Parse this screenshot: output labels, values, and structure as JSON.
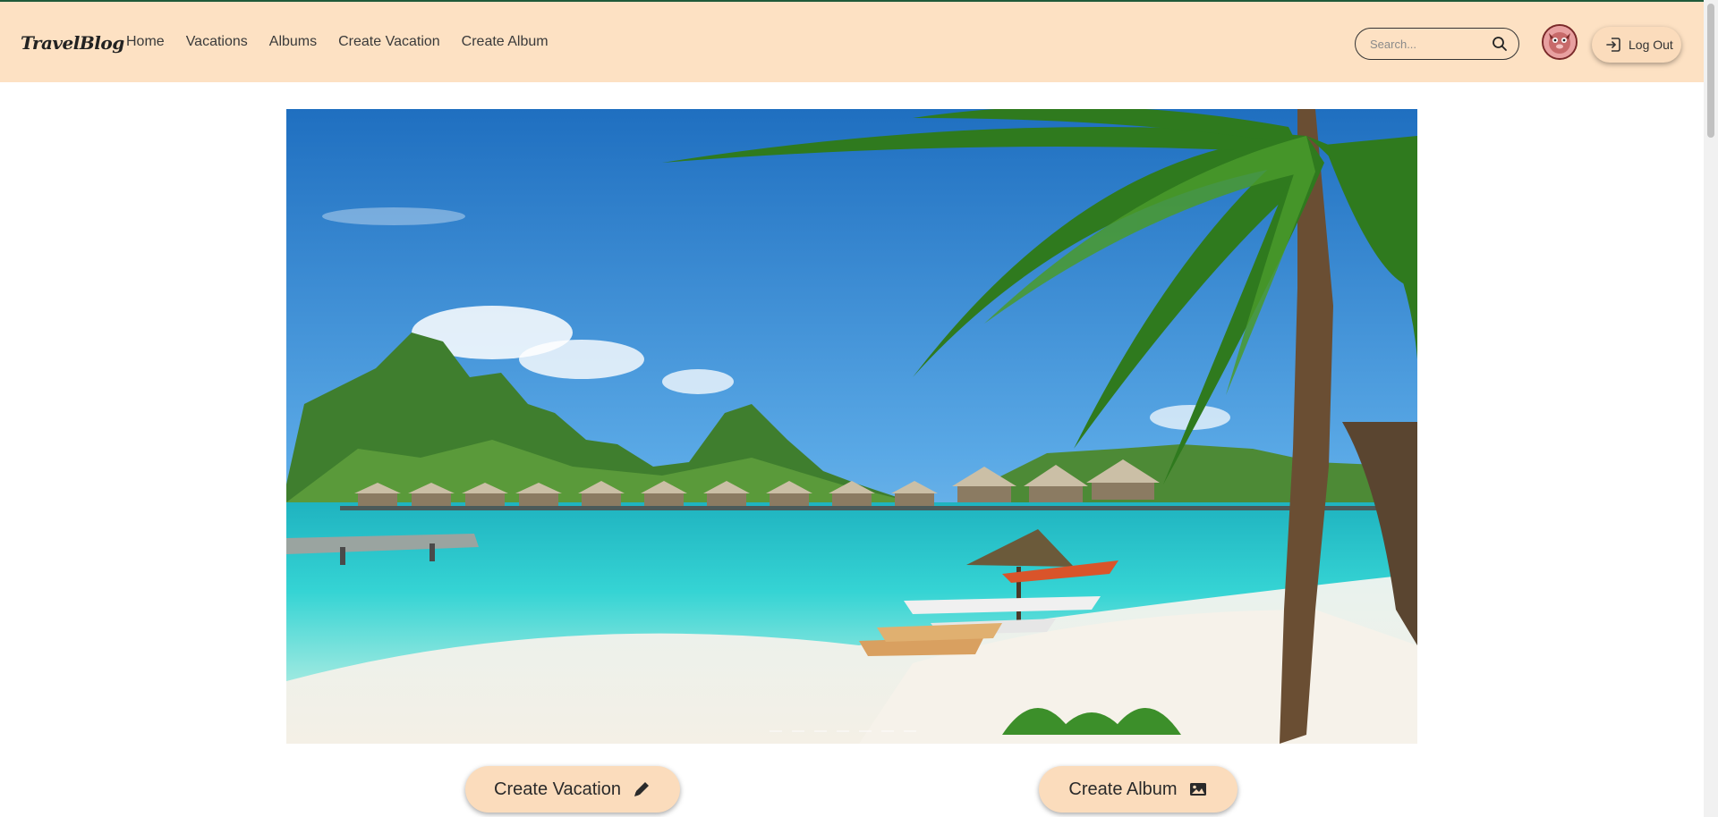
{
  "brand": "TravelBlog",
  "nav": {
    "links": [
      "Home",
      "Vacations",
      "Albums",
      "Create Vacation",
      "Create Album"
    ]
  },
  "search": {
    "placeholder": "Search...",
    "icon": "search-icon"
  },
  "user": {
    "avatar_icon": "avatar-icon",
    "logout_label": "Log Out",
    "logout_icon": "logout-icon"
  },
  "actions": {
    "create_vacation": "Create Vacation",
    "create_vacation_icon": "pencil-icon",
    "create_album": "Create Album",
    "create_album_icon": "image-icon"
  },
  "colors": {
    "navbar": "#fde1c3",
    "button": "#fbdcbc",
    "topline": "#1f5a3a"
  }
}
